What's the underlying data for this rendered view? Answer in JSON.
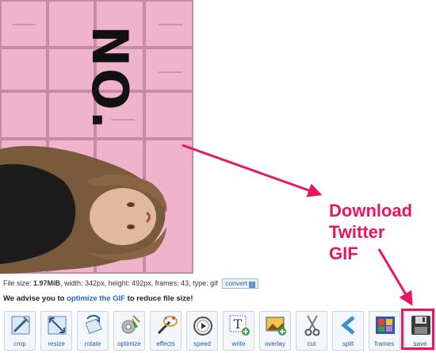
{
  "file_info": {
    "prefix": "File size: ",
    "size": "1.97MiB",
    "rest": ", width: 342px, height: 492px, frames: 43, type: gif",
    "convert_label": "convert"
  },
  "advice": {
    "before": "We advise you to ",
    "link": "optimize the GIF",
    "after": " to reduce file size!"
  },
  "preview": {
    "overlay_text": "NO."
  },
  "toolbar": [
    {
      "label": "crop",
      "icon": "crop-icon"
    },
    {
      "label": "resize",
      "icon": "resize-icon"
    },
    {
      "label": "rotate",
      "icon": "rotate-icon"
    },
    {
      "label": "optimize",
      "icon": "optimize-icon"
    },
    {
      "label": "effects",
      "icon": "effects-icon"
    },
    {
      "label": "speed",
      "icon": "speed-icon"
    },
    {
      "label": "write",
      "icon": "write-icon"
    },
    {
      "label": "overlay",
      "icon": "overlay-icon"
    },
    {
      "label": "cut",
      "icon": "cut-icon"
    },
    {
      "label": "split",
      "icon": "split-icon"
    },
    {
      "label": "frames",
      "icon": "frames-icon"
    },
    {
      "label": "save",
      "icon": "save-icon"
    }
  ],
  "annotation": {
    "lines": [
      "Download",
      "Twitter",
      "GIF"
    ],
    "color": "#e8175d"
  }
}
